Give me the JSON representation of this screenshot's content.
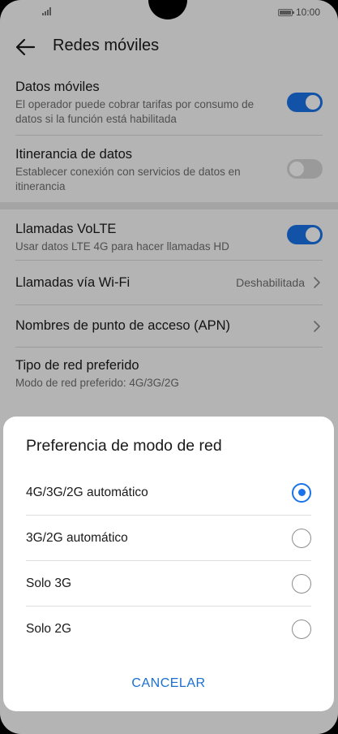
{
  "status_bar": {
    "time": "10:00"
  },
  "app_bar": {
    "title": "Redes móviles"
  },
  "settings": {
    "datos_moviles": {
      "label": "Datos móviles",
      "description": "El operador puede cobrar tarifas por consumo de datos si la función está habilitada",
      "enabled": true
    },
    "itinerancia": {
      "label": "Itinerancia de datos",
      "description": "Establecer conexión con servicios de datos en itinerancia",
      "enabled": false
    },
    "volte": {
      "label": "Llamadas VoLTE",
      "description": "Usar datos LTE 4G para hacer llamadas HD",
      "enabled": true
    },
    "wifi_calls": {
      "label": "Llamadas vía Wi-Fi",
      "value": "Deshabilitada"
    },
    "apn": {
      "label": "Nombres de punto de acceso (APN)"
    },
    "network_type": {
      "label": "Tipo de red preferido",
      "description": "Modo de red preferido: 4G/3G/2G"
    }
  },
  "dialog": {
    "title": "Preferencia de modo de red",
    "options": [
      {
        "label": "4G/3G/2G automático",
        "selected": true
      },
      {
        "label": "3G/2G automático",
        "selected": false
      },
      {
        "label": "Solo 3G",
        "selected": false
      },
      {
        "label": "Solo 2G",
        "selected": false
      }
    ],
    "cancel_label": "CANCELAR"
  },
  "colors": {
    "accent": "#1a73e8"
  }
}
